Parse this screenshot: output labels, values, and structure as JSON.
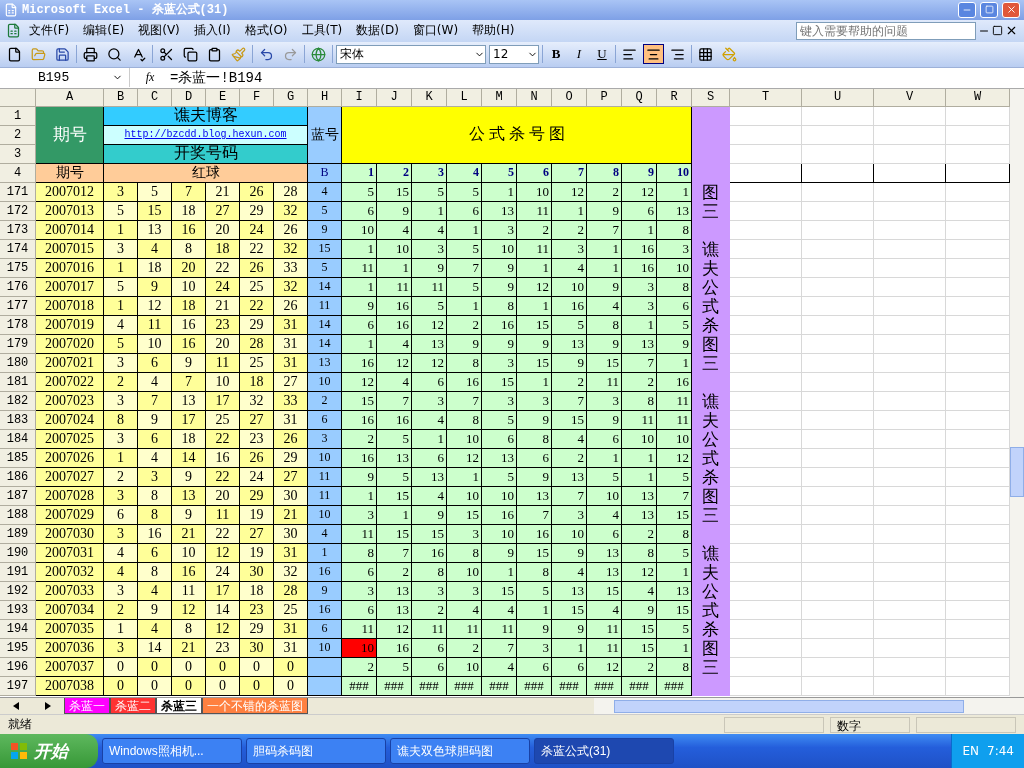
{
  "window": {
    "title": "Microsoft Excel - 杀蓝公式(31)"
  },
  "menu": [
    "文件(F)",
    "编辑(E)",
    "视图(V)",
    "插入(I)",
    "格式(O)",
    "工具(T)",
    "数据(D)",
    "窗口(W)",
    "帮助(H)"
  ],
  "help_box": {
    "placeholder": "键入需要帮助的问题"
  },
  "toolbar": {
    "font": "宋体",
    "size": "12",
    "bold": "B",
    "italic": "I",
    "underline": "U",
    "align": [
      {
        "kind": "left",
        "selected": false
      },
      {
        "kind": "center",
        "selected": true
      },
      {
        "kind": "right",
        "selected": false
      }
    ]
  },
  "formula_bar": {
    "name_box": "B195",
    "fx": "fx",
    "formula": "=杀蓝一!B194"
  },
  "columns": [
    "A",
    "B",
    "C",
    "D",
    "E",
    "F",
    "G",
    "H",
    "I",
    "J",
    "K",
    "L",
    "M",
    "N",
    "O",
    "P",
    "Q",
    "R",
    "S",
    "T",
    "U",
    "V",
    "W"
  ],
  "top_rows": [
    "1",
    "2",
    "3",
    "4"
  ],
  "header": {
    "issue_title": "期号",
    "blog": "谯夫博客",
    "link": "http://bzcdd.blog.hexun.com",
    "draw_label": "开奖号码",
    "blue_label": "蓝号",
    "chart_title": "公 式 杀 号 图",
    "issue_label": "期号",
    "red_label": "红球",
    "blue_col": "B",
    "formula_cols": [
      "1",
      "2",
      "3",
      "4",
      "5",
      "6",
      "7",
      "8",
      "9",
      "10"
    ]
  },
  "rows": [
    {
      "n": "171",
      "issue": "2007012",
      "red": [
        "3",
        "5",
        "7",
        "21",
        "26",
        "28"
      ],
      "blue": "4",
      "kill": [
        "5",
        "15",
        "5",
        "5",
        "1",
        "10",
        "12",
        "2",
        "12",
        "1"
      ],
      "flag": [
        false,
        false,
        false,
        false,
        false,
        false,
        false,
        false,
        false,
        false
      ],
      "side": "图"
    },
    {
      "n": "172",
      "issue": "2007013",
      "red": [
        "5",
        "15",
        "18",
        "27",
        "29",
        "32"
      ],
      "blue": "5",
      "kill": [
        "6",
        "9",
        "1",
        "6",
        "13",
        "11",
        "1",
        "9",
        "6",
        "13"
      ],
      "flag": [
        false,
        false,
        false,
        false,
        false,
        false,
        false,
        false,
        false,
        false
      ],
      "side": "三"
    },
    {
      "n": "173",
      "issue": "2007014",
      "red": [
        "1",
        "13",
        "16",
        "20",
        "24",
        "26"
      ],
      "blue": "9",
      "kill": [
        "10",
        "4",
        "4",
        "1",
        "3",
        "2",
        "2",
        "7",
        "1",
        "8"
      ],
      "flag": [
        false,
        false,
        false,
        false,
        false,
        false,
        false,
        false,
        false,
        false
      ]
    },
    {
      "n": "174",
      "issue": "2007015",
      "red": [
        "3",
        "4",
        "8",
        "18",
        "22",
        "32"
      ],
      "blue": "15",
      "kill": [
        "1",
        "10",
        "3",
        "5",
        "10",
        "11",
        "3",
        "1",
        "16",
        "3"
      ],
      "flag": [
        false,
        false,
        false,
        false,
        false,
        false,
        false,
        false,
        false,
        false
      ],
      "side": "谯"
    },
    {
      "n": "175",
      "issue": "2007016",
      "red": [
        "1",
        "18",
        "20",
        "22",
        "26",
        "33"
      ],
      "blue": "5",
      "kill": [
        "11",
        "1",
        "9",
        "7",
        "9",
        "1",
        "4",
        "1",
        "16",
        "10"
      ],
      "flag": [
        false,
        false,
        false,
        false,
        false,
        false,
        false,
        false,
        false,
        false
      ],
      "side": "夫"
    },
    {
      "n": "176",
      "issue": "2007017",
      "red": [
        "5",
        "9",
        "10",
        "24",
        "25",
        "32"
      ],
      "blue": "14",
      "kill": [
        "1",
        "11",
        "11",
        "5",
        "9",
        "12",
        "10",
        "9",
        "3",
        "8"
      ],
      "flag": [
        false,
        false,
        false,
        false,
        false,
        false,
        false,
        false,
        false,
        false
      ],
      "side": "公"
    },
    {
      "n": "177",
      "issue": "2007018",
      "red": [
        "1",
        "12",
        "18",
        "21",
        "22",
        "26"
      ],
      "blue": "11",
      "kill": [
        "9",
        "16",
        "5",
        "1",
        "8",
        "1",
        "16",
        "4",
        "3",
        "6"
      ],
      "flag": [
        false,
        false,
        false,
        false,
        false,
        false,
        false,
        false,
        false,
        false
      ],
      "side": "式"
    },
    {
      "n": "178",
      "issue": "2007019",
      "red": [
        "4",
        "11",
        "16",
        "23",
        "29",
        "31"
      ],
      "blue": "14",
      "kill": [
        "6",
        "16",
        "12",
        "2",
        "16",
        "15",
        "5",
        "8",
        "1",
        "5"
      ],
      "flag": [
        false,
        false,
        false,
        false,
        false,
        false,
        false,
        false,
        false,
        false
      ],
      "side": "杀"
    },
    {
      "n": "179",
      "issue": "2007020",
      "red": [
        "5",
        "10",
        "16",
        "20",
        "28",
        "31"
      ],
      "blue": "14",
      "kill": [
        "1",
        "4",
        "13",
        "9",
        "9",
        "9",
        "13",
        "9",
        "13",
        "9"
      ],
      "flag": [
        false,
        false,
        false,
        false,
        false,
        false,
        false,
        false,
        false,
        false
      ],
      "side": "图"
    },
    {
      "n": "180",
      "issue": "2007021",
      "red": [
        "3",
        "6",
        "9",
        "11",
        "25",
        "31"
      ],
      "blue": "13",
      "kill": [
        "16",
        "12",
        "12",
        "8",
        "3",
        "15",
        "9",
        "15",
        "7",
        "1"
      ],
      "flag": [
        false,
        false,
        false,
        false,
        false,
        false,
        false,
        false,
        false,
        false
      ],
      "side": "三"
    },
    {
      "n": "181",
      "issue": "2007022",
      "red": [
        "2",
        "4",
        "7",
        "10",
        "18",
        "27"
      ],
      "blue": "10",
      "kill": [
        "12",
        "4",
        "6",
        "16",
        "15",
        "1",
        "2",
        "11",
        "2",
        "16"
      ],
      "flag": [
        false,
        false,
        false,
        false,
        false,
        false,
        false,
        false,
        false,
        false
      ]
    },
    {
      "n": "182",
      "issue": "2007023",
      "red": [
        "3",
        "7",
        "13",
        "17",
        "32",
        "33"
      ],
      "blue": "2",
      "kill": [
        "15",
        "7",
        "3",
        "7",
        "3",
        "3",
        "7",
        "3",
        "8",
        "11"
      ],
      "flag": [
        false,
        false,
        false,
        false,
        false,
        false,
        false,
        false,
        false,
        false
      ],
      "side": "谯"
    },
    {
      "n": "183",
      "issue": "2007024",
      "red": [
        "8",
        "9",
        "17",
        "25",
        "27",
        "31"
      ],
      "blue": "6",
      "kill": [
        "16",
        "16",
        "4",
        "8",
        "5",
        "9",
        "15",
        "9",
        "11",
        "11"
      ],
      "flag": [
        false,
        false,
        false,
        false,
        false,
        false,
        false,
        false,
        false,
        false
      ],
      "side": "夫"
    },
    {
      "n": "184",
      "issue": "2007025",
      "red": [
        "3",
        "6",
        "18",
        "22",
        "23",
        "26"
      ],
      "blue": "3",
      "kill": [
        "2",
        "5",
        "1",
        "10",
        "6",
        "8",
        "4",
        "6",
        "10",
        "10"
      ],
      "flag": [
        false,
        false,
        false,
        false,
        false,
        false,
        false,
        false,
        false,
        false
      ],
      "side": "公"
    },
    {
      "n": "185",
      "issue": "2007026",
      "red": [
        "1",
        "4",
        "14",
        "16",
        "26",
        "29"
      ],
      "blue": "10",
      "kill": [
        "16",
        "13",
        "6",
        "12",
        "13",
        "6",
        "2",
        "1",
        "1",
        "12"
      ],
      "flag": [
        false,
        false,
        false,
        false,
        false,
        false,
        false,
        false,
        false,
        false
      ],
      "side": "式"
    },
    {
      "n": "186",
      "issue": "2007027",
      "red": [
        "2",
        "3",
        "9",
        "22",
        "24",
        "27"
      ],
      "blue": "11",
      "kill": [
        "9",
        "5",
        "13",
        "1",
        "5",
        "9",
        "13",
        "5",
        "1",
        "5"
      ],
      "flag": [
        false,
        false,
        false,
        false,
        false,
        false,
        false,
        false,
        false,
        false
      ],
      "side": "杀"
    },
    {
      "n": "187",
      "issue": "2007028",
      "red": [
        "3",
        "8",
        "13",
        "20",
        "29",
        "30"
      ],
      "blue": "11",
      "kill": [
        "1",
        "15",
        "4",
        "10",
        "10",
        "13",
        "7",
        "10",
        "13",
        "7"
      ],
      "flag": [
        false,
        false,
        false,
        false,
        false,
        false,
        false,
        false,
        false,
        false
      ],
      "side": "图"
    },
    {
      "n": "188",
      "issue": "2007029",
      "red": [
        "6",
        "8",
        "9",
        "11",
        "19",
        "21"
      ],
      "blue": "10",
      "kill": [
        "3",
        "1",
        "9",
        "15",
        "16",
        "7",
        "3",
        "4",
        "13",
        "15"
      ],
      "flag": [
        false,
        false,
        false,
        false,
        false,
        false,
        false,
        false,
        false,
        false
      ],
      "side": "三"
    },
    {
      "n": "189",
      "issue": "2007030",
      "red": [
        "3",
        "16",
        "21",
        "22",
        "27",
        "30"
      ],
      "blue": "4",
      "kill": [
        "11",
        "15",
        "15",
        "3",
        "10",
        "16",
        "10",
        "6",
        "2",
        "8"
      ],
      "flag": [
        false,
        false,
        false,
        false,
        false,
        false,
        false,
        false,
        false,
        false
      ]
    },
    {
      "n": "190",
      "issue": "2007031",
      "red": [
        "4",
        "6",
        "10",
        "12",
        "19",
        "31"
      ],
      "blue": "1",
      "kill": [
        "8",
        "7",
        "16",
        "8",
        "9",
        "15",
        "9",
        "13",
        "8",
        "5"
      ],
      "flag": [
        false,
        false,
        false,
        false,
        false,
        false,
        false,
        false,
        false,
        false
      ],
      "side": "谯"
    },
    {
      "n": "191",
      "issue": "2007032",
      "red": [
        "4",
        "8",
        "16",
        "24",
        "30",
        "32"
      ],
      "blue": "16",
      "kill": [
        "6",
        "2",
        "8",
        "10",
        "1",
        "8",
        "4",
        "13",
        "12",
        "1"
      ],
      "flag": [
        false,
        false,
        false,
        false,
        false,
        false,
        false,
        false,
        false,
        false
      ],
      "side": "夫"
    },
    {
      "n": "192",
      "issue": "2007033",
      "red": [
        "3",
        "4",
        "11",
        "17",
        "18",
        "28"
      ],
      "blue": "9",
      "kill": [
        "3",
        "13",
        "3",
        "3",
        "15",
        "5",
        "13",
        "15",
        "4",
        "13"
      ],
      "flag": [
        false,
        false,
        false,
        false,
        false,
        false,
        false,
        false,
        false,
        false
      ],
      "side": "公"
    },
    {
      "n": "193",
      "issue": "2007034",
      "red": [
        "2",
        "9",
        "12",
        "14",
        "23",
        "25"
      ],
      "blue": "16",
      "kill": [
        "6",
        "13",
        "2",
        "4",
        "4",
        "1",
        "15",
        "4",
        "9",
        "15"
      ],
      "flag": [
        false,
        false,
        false,
        false,
        false,
        false,
        false,
        false,
        false,
        false
      ],
      "side": "式"
    },
    {
      "n": "194",
      "issue": "2007035",
      "red": [
        "1",
        "4",
        "8",
        "12",
        "29",
        "31"
      ],
      "blue": "6",
      "kill": [
        "11",
        "12",
        "11",
        "11",
        "11",
        "9",
        "9",
        "11",
        "15",
        "5"
      ],
      "flag": [
        false,
        false,
        false,
        false,
        false,
        false,
        false,
        false,
        false,
        false
      ],
      "side": "杀"
    },
    {
      "n": "195",
      "issue": "2007036",
      "red": [
        "3",
        "14",
        "21",
        "23",
        "30",
        "31"
      ],
      "blue": "10",
      "kill": [
        "10",
        "16",
        "6",
        "2",
        "7",
        "3",
        "1",
        "11",
        "15",
        "1"
      ],
      "flag": [
        true,
        false,
        false,
        false,
        false,
        false,
        false,
        false,
        false,
        false
      ],
      "side": "图"
    },
    {
      "n": "196",
      "issue": "2007037",
      "red": [
        "0",
        "0",
        "0",
        "0",
        "0",
        "0"
      ],
      "kill": [
        "2",
        "5",
        "6",
        "10",
        "4",
        "6",
        "6",
        "12",
        "2",
        "8"
      ],
      "flag": [
        false,
        false,
        false,
        false,
        false,
        false,
        false,
        false,
        false,
        false
      ],
      "side": "三"
    },
    {
      "n": "197",
      "issue": "2007038",
      "red": [
        "0",
        "0",
        "0",
        "0",
        "0",
        "0"
      ],
      "kill": [
        "###",
        "###",
        "###",
        "###",
        "###",
        "###",
        "###",
        "###",
        "###",
        "###"
      ],
      "flag": [
        false,
        false,
        false,
        false,
        false,
        false,
        false,
        false,
        false,
        false
      ]
    }
  ],
  "sheets": [
    {
      "label": "杀蓝一",
      "selected": false,
      "color": "#ff00ff"
    },
    {
      "label": "杀蓝二",
      "selected": false,
      "color": "#ff3333"
    },
    {
      "label": "杀蓝三",
      "selected": true,
      "color": "#ffffff"
    },
    {
      "label": "一个不错的杀蓝图",
      "selected": false,
      "color": "#ff8040"
    }
  ],
  "status": {
    "left": "就绪",
    "mode": "数字"
  },
  "taskbar": {
    "start": "开始",
    "tasks": [
      {
        "label": "Windows照相机...",
        "selected": false
      },
      {
        "label": "胆码杀码图",
        "selected": false
      },
      {
        "label": "谯夫双色球胆码图",
        "selected": false
      },
      {
        "label": "杀蓝公式(31)",
        "selected": true
      }
    ],
    "lang": "EN",
    "time": "7:44"
  }
}
